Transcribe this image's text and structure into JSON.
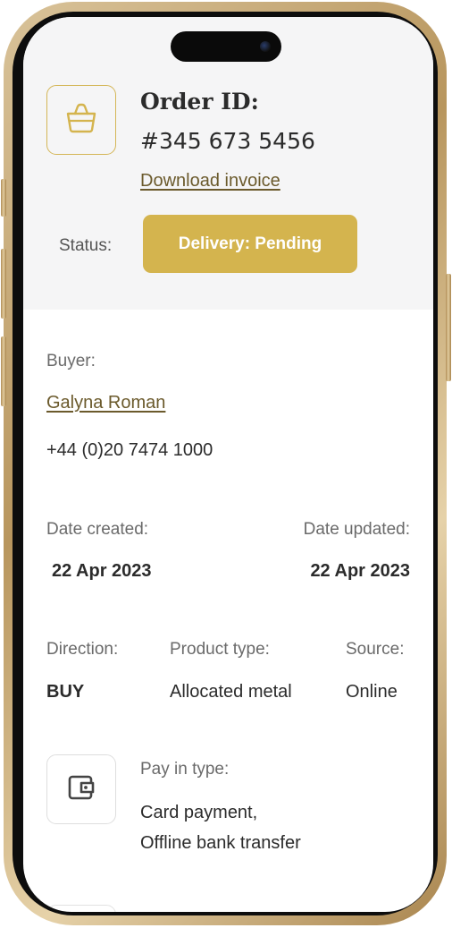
{
  "order": {
    "label": "Order ID:",
    "number": "#345 673 5456",
    "invoice_link": "Download invoice",
    "status_label": "Status:",
    "status_value": "Delivery: Pending"
  },
  "buyer": {
    "label": "Buyer:",
    "name": "Galyna Roman",
    "phone": "+44 (0)20 7474 1000"
  },
  "dates": {
    "created_label": "Date created:",
    "created_value": "22 Apr 2023",
    "updated_label": "Date updated:",
    "updated_value": "22 Apr 2023"
  },
  "details": {
    "direction_label": "Direction:",
    "direction_value": "BUY",
    "product_type_label": "Product type:",
    "product_type_value": "Allocated metal",
    "source_label": "Source:",
    "source_value": "Online"
  },
  "payment": {
    "label": "Pay in type:",
    "value_line1": "Card payment,",
    "value_line2": "Offline bank transfer"
  },
  "icons": {
    "order": "shopping-bag-icon",
    "payment": "wallet-icon"
  },
  "colors": {
    "accent": "#d4b44e",
    "link": "#6b5a2c",
    "header_bg": "#f5f5f6"
  }
}
